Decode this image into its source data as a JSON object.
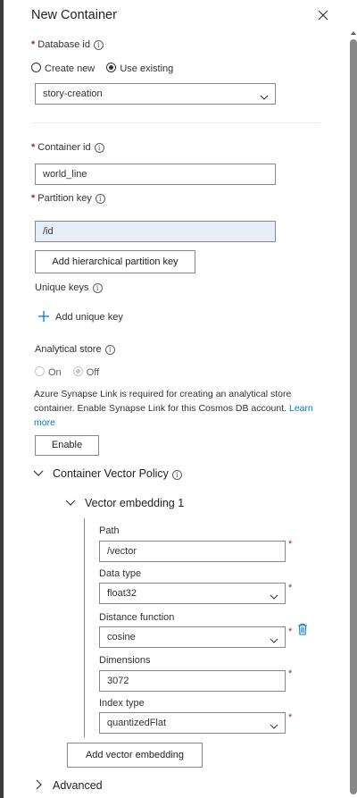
{
  "panel": {
    "title": "New Container"
  },
  "database": {
    "label": "Database id",
    "required_mark": "*",
    "radio_create": "Create new",
    "radio_existing": "Use existing",
    "selected": "story-creation"
  },
  "container": {
    "label": "Container id",
    "required_mark": "*",
    "value": "world_line"
  },
  "partition": {
    "label": "Partition key",
    "required_mark": "*",
    "value": "/id",
    "add_button": "Add hierarchical partition key"
  },
  "unique_keys": {
    "label": "Unique keys",
    "add_label": "Add unique key"
  },
  "analytical": {
    "label": "Analytical store",
    "on": "On",
    "off": "Off",
    "note": "Azure Synapse Link is required for creating an analytical store container. Enable Synapse Link for this Cosmos DB account.",
    "learn_more": "Learn more",
    "enable_button": "Enable"
  },
  "vector_policy": {
    "title": "Container Vector Policy",
    "embedding_title": "Vector embedding 1",
    "path_label": "Path",
    "path_value": "/vector",
    "data_type_label": "Data type",
    "data_type_value": "float32",
    "distance_label": "Distance function",
    "distance_value": "cosine",
    "dimensions_label": "Dimensions",
    "dimensions_value": "3072",
    "index_type_label": "Index type",
    "index_type_value": "quantizedFlat",
    "add_button": "Add vector embedding",
    "required_mark": "*"
  },
  "advanced": {
    "title": "Advanced"
  },
  "colors": {
    "accent": "#0078d4",
    "required": "#a4262c",
    "filled_bg": "#e8eef9"
  }
}
